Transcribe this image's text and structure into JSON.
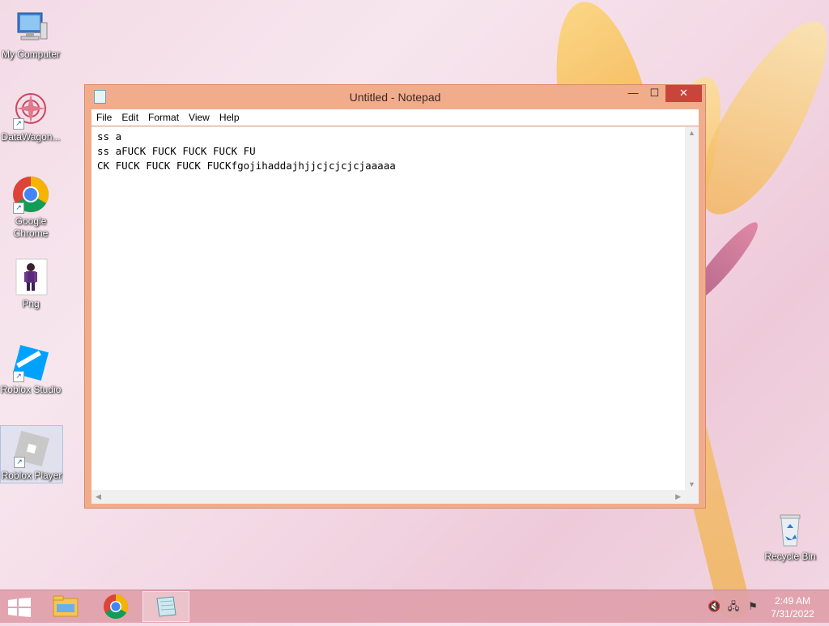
{
  "desktop": {
    "icons": [
      {
        "label": "My Computer",
        "icon": "computer-icon"
      },
      {
        "label": "DataWagon...",
        "icon": "datawagon-icon"
      },
      {
        "label": "Google Chrome",
        "icon": "chrome-icon"
      },
      {
        "label": "Png",
        "icon": "image-file-icon"
      },
      {
        "label": "Roblox Studio",
        "icon": "roblox-studio-icon"
      },
      {
        "label": "Roblox Player",
        "icon": "roblox-player-icon"
      },
      {
        "label": "Recycle Bin",
        "icon": "recycle-bin-icon"
      }
    ]
  },
  "notepad": {
    "title": "Untitled - Notepad",
    "controls": {
      "minimize": "—",
      "maximize": "☐",
      "close": "✕"
    },
    "menu": [
      "File",
      "Edit",
      "Format",
      "View",
      "Help"
    ],
    "content": "ss a\nss aFUCK FUCK FUCK FUCK FU\nCK FUCK FUCK FUCK FUCKfgojihaddajhjjcjcjcjcjaaaaa"
  },
  "taskbar": {
    "pinned": [
      "file-explorer-icon",
      "chrome-icon",
      "notepad-icon"
    ],
    "tray": [
      "volume-muted-icon",
      "network-icon",
      "action-center-icon"
    ],
    "clock": {
      "time": "2:49 AM",
      "date": "7/31/2022"
    }
  }
}
